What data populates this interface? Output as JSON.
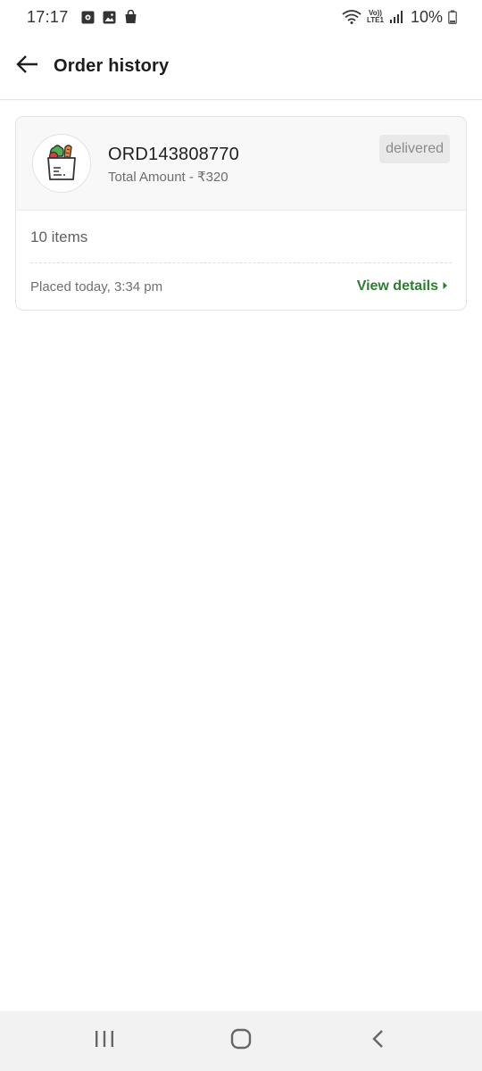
{
  "status_bar": {
    "time": "17:17",
    "battery": "10%",
    "network_top": "Vo))",
    "network_bottom": "LTE1",
    "icons": [
      "notification-icon",
      "gallery-icon",
      "bag-icon",
      "wifi-icon",
      "signal-icon",
      "battery-icon"
    ]
  },
  "header": {
    "title": "Order history",
    "back_icon": "back-arrow-icon"
  },
  "order": {
    "id": "ORD143808770",
    "amount": "Total Amount - ₹320",
    "status": "delivered",
    "items": "10 items",
    "placed": "Placed today, 3:34 pm",
    "action_label": "View details",
    "thumb_icon": "grocery-bag-icon",
    "colors": {
      "accent": "#2e7d32",
      "badge_bg": "#e9e9e9",
      "badge_text": "#8a8a8a"
    }
  },
  "nav_bar": {
    "buttons": [
      "recents-icon",
      "home-icon",
      "back-icon"
    ]
  }
}
